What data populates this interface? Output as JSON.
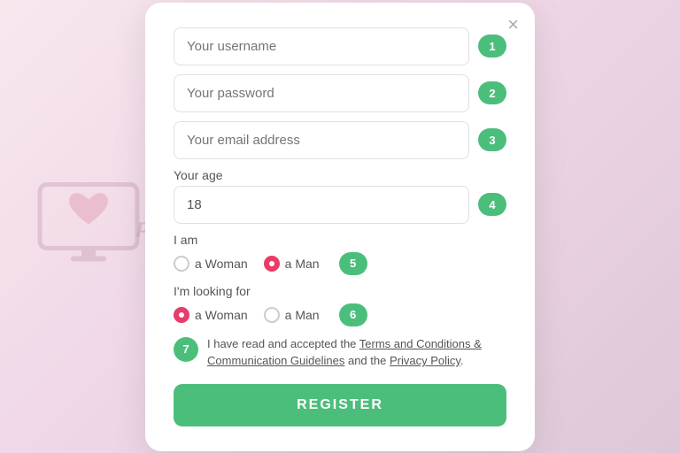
{
  "background": {
    "color": "#f5dde8"
  },
  "watermark": {
    "site": "perfect.is"
  },
  "modal": {
    "close_label": "×",
    "fields": [
      {
        "id": 1,
        "placeholder": "Your username",
        "type": "text",
        "badge": "1"
      },
      {
        "id": 2,
        "placeholder": "Your password",
        "type": "password",
        "badge": "2"
      },
      {
        "id": 3,
        "placeholder": "Your email address",
        "type": "email",
        "badge": "3"
      }
    ],
    "age_label": "Your age",
    "age_value": "18",
    "age_badge": "4",
    "iam_label": "I am",
    "iam_options": [
      {
        "label": "a Woman",
        "checked": false
      },
      {
        "label": "a Man",
        "checked": true
      }
    ],
    "iam_badge": "5",
    "looking_label": "I'm looking for",
    "looking_options": [
      {
        "label": "a Woman",
        "checked": true
      },
      {
        "label": "a Man",
        "checked": false
      }
    ],
    "looking_badge": "6",
    "terms_badge": "7",
    "terms_text_before": "I have read and accepted the ",
    "terms_link1": "Terms and Conditions & Communication Guidelines",
    "terms_text_mid": " and the ",
    "terms_link2": "Privacy Policy",
    "terms_text_end": ".",
    "register_label": "REGISTER"
  }
}
